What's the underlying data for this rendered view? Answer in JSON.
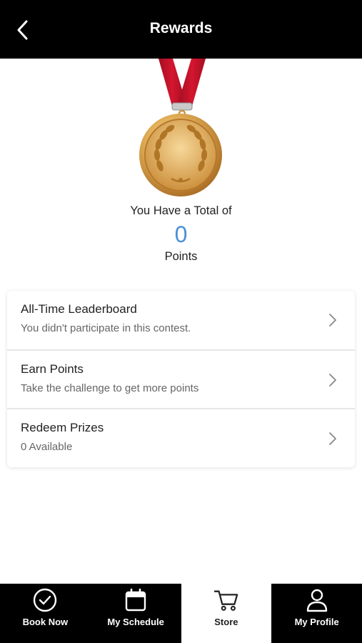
{
  "header": {
    "title": "Rewards",
    "back_icon": "chevron-left-icon"
  },
  "points": {
    "intro": "You Have a Total of",
    "value": "0",
    "unit": "Points"
  },
  "menu": [
    {
      "title": "All-Time Leaderboard",
      "subtitle": "You didn't participate in this contest."
    },
    {
      "title": "Earn Points",
      "subtitle": "Take the challenge to get more points"
    },
    {
      "title": "Redeem Prizes",
      "subtitle": "0 Available"
    }
  ],
  "tabs": [
    {
      "label": "Book Now",
      "icon": "check-circle-icon",
      "active": false
    },
    {
      "label": "My Schedule",
      "icon": "calendar-icon",
      "active": false
    },
    {
      "label": "Store",
      "icon": "cart-icon",
      "active": true
    },
    {
      "label": "My Profile",
      "icon": "person-icon",
      "active": false
    }
  ],
  "colors": {
    "accent": "#4a90d9",
    "header_bg": "#000000",
    "ribbon": "#c8102e",
    "medal_gold": "#d9a441"
  }
}
